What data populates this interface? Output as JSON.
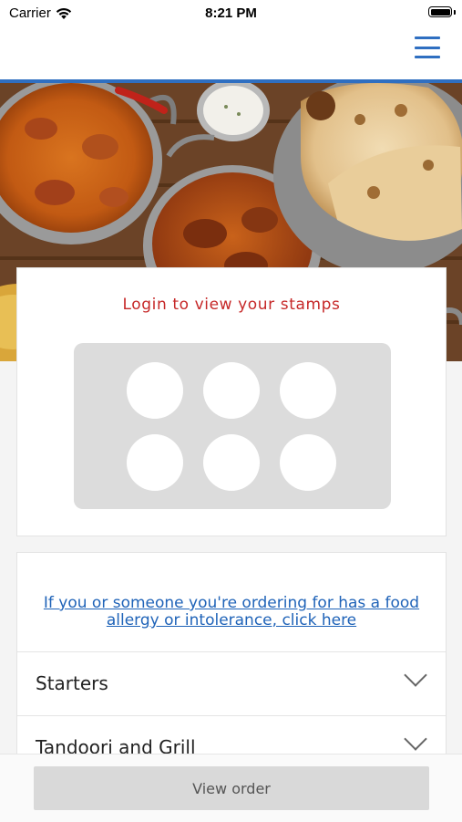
{
  "status_bar": {
    "carrier": "Carrier",
    "time": "8:21 PM",
    "icons": [
      "wifi-icon",
      "battery-icon"
    ]
  },
  "header": {
    "menu_icon": "hamburger-menu-icon",
    "accent_color": "#2f6fc1"
  },
  "stamps": {
    "title": "Login to view your stamps",
    "title_color": "#c62828",
    "stamp_count": 6
  },
  "menu": {
    "allergy_link": "If you or someone you're ordering for has a food allergy or intolerance, click here",
    "link_color": "#1f63b8",
    "categories": [
      {
        "label": "Starters",
        "icon": "chevron-down-icon"
      },
      {
        "label": "Tandoori and Grill",
        "icon": "chevron-down-icon"
      }
    ]
  },
  "footer": {
    "view_order_label": "View order"
  }
}
